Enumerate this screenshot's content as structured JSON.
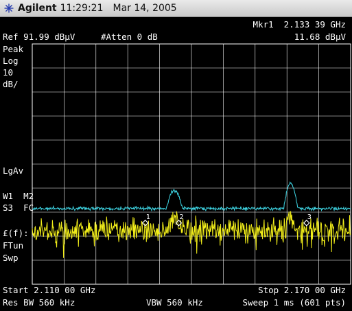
{
  "titlebar": {
    "brand": "Agilent",
    "time": "11:29:21",
    "date": "Mar 14, 2005",
    "logo_icon": "agilent-spark-icon"
  },
  "header": {
    "marker_label": "Mkr1  2.133 39 GHz",
    "ref_level": "Ref 91.99 dBμV",
    "attenuation": "#Atten 0 dB",
    "marker_value": "11.68 dBμV"
  },
  "left_panel": {
    "detector": "Peak",
    "scale_type": "Log",
    "scale_value": "10",
    "scale_unit": "dB/",
    "avg_type": "LgAv",
    "trace_line1": "W1  M2",
    "trace_line2": "S3  FC",
    "ffunction": "£(f):",
    "ftun": "FTun",
    "swp": "Swp"
  },
  "footer": {
    "start": "Start 2.110 00 GHz",
    "stop": "Stop 2.170 00 GHz",
    "res_bw": "Res BW 560 kHz",
    "vbw": "VBW 560 kHz",
    "sweep": "Sweep 1 ms (601 pts)"
  },
  "markers": [
    {
      "label": "1",
      "x_ghz": 2.1313
    },
    {
      "label": "2",
      "x_ghz": 2.1376
    },
    {
      "label": "3",
      "x_ghz": 2.1617
    }
  ],
  "colors": {
    "background": "#000000",
    "graticule": "#ffffff",
    "trace_max": "#3fd9e8",
    "trace_live": "#f2ee1a",
    "text": "#ffffff"
  },
  "chart_data": {
    "type": "line",
    "x_range_ghz": [
      2.11,
      2.17
    ],
    "y_divisions": 10,
    "grid": true,
    "points": 601,
    "series": [
      {
        "color": "#3fd9e8",
        "noise_div": 6.85,
        "bumps": [
          {
            "center_ghz": 2.1368,
            "width_ghz": 0.0015,
            "height_div": 0.75
          },
          {
            "center_ghz": 2.1587,
            "width_ghz": 0.0013,
            "height_div": 1.05
          }
        ]
      },
      {
        "color": "#f2ee1a",
        "noise_div": 7.75,
        "bumps": [
          {
            "center_ghz": 2.1368,
            "width_ghz": 0.001,
            "height_div": 0.45
          },
          {
            "center_ghz": 2.1587,
            "width_ghz": 0.001,
            "height_div": 0.55
          }
        ]
      }
    ]
  }
}
